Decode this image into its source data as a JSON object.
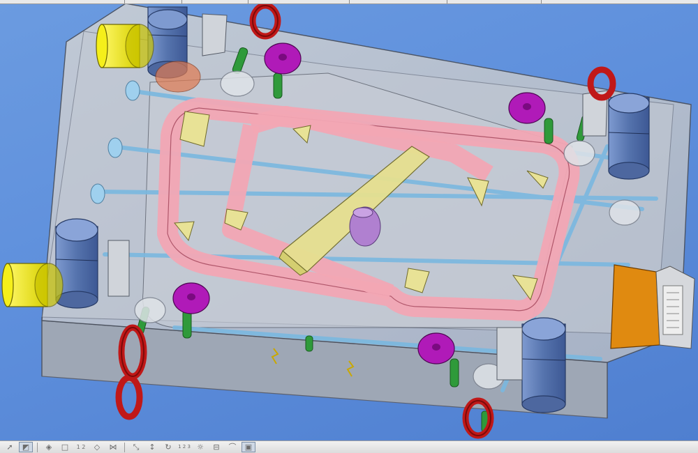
{
  "app": {
    "name": "CAD mold assembly viewport"
  },
  "viewport": {
    "background_color": "#5f8fd6",
    "parts": [
      {
        "name": "base-plate",
        "color": "#b8c0cc"
      },
      {
        "name": "cooling-channel-loop",
        "color": "#f2a6b4"
      },
      {
        "name": "insert-rail",
        "color": "#e6e090"
      },
      {
        "name": "ejector-pins",
        "color": "#2f9a3a"
      },
      {
        "name": "lifting-eyes",
        "color": "#c01818"
      },
      {
        "name": "guide-pillars",
        "color": "#5f7fb5"
      },
      {
        "name": "caps",
        "color": "#f5ef1a"
      },
      {
        "name": "plugs",
        "color": "#b01ab8"
      },
      {
        "name": "connector",
        "color": "#e08a10"
      },
      {
        "name": "water-lines",
        "color": "#7ab8e0"
      }
    ]
  },
  "toolbar": {
    "buttons": [
      {
        "icon": "select-arrow-icon"
      },
      {
        "icon": "view-orientation-icon",
        "active": true
      },
      {
        "icon": "shaded-icon"
      },
      {
        "icon": "wireframe-icon"
      },
      {
        "icon": "step-12-icon"
      },
      {
        "icon": "measure-icon"
      },
      {
        "icon": "mirror-icon"
      },
      {
        "icon": "zoom-icon"
      },
      {
        "icon": "pan-icon"
      },
      {
        "icon": "rotate-icon"
      },
      {
        "icon": "step-123-icon"
      },
      {
        "icon": "light-icon"
      },
      {
        "icon": "section-icon"
      },
      {
        "icon": "perspective-icon"
      },
      {
        "icon": "render-mode-icon",
        "active": true
      }
    ],
    "labels": {
      "step12": "1 2",
      "step123": "1 2 3"
    }
  }
}
